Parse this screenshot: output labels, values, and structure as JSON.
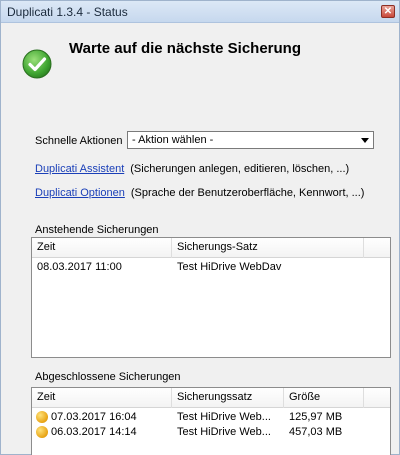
{
  "window": {
    "title": "Duplicati 1.3.4 - Status",
    "close_glyph": "✕"
  },
  "status": {
    "icon": "check-circle-icon",
    "text": "Warte auf die nächste Sicherung",
    "accent_color": "#4caf3c"
  },
  "quick_actions": {
    "label": "Schnelle Aktionen",
    "selected": "- Aktion wählen -"
  },
  "links": [
    {
      "label": "Duplicati Assistent",
      "description": "(Sicherungen anlegen, editieren, löschen, ...)"
    },
    {
      "label": "Duplicati Optionen",
      "description": "(Sprache der Benutzeroberfläche, Kennwort, ...)"
    }
  ],
  "pending": {
    "label": "Anstehende Sicherungen",
    "columns": [
      "Zeit",
      "Sicherungs-Satz"
    ],
    "rows": [
      {
        "time": "08.03.2017 11:00",
        "set": "Test HiDrive WebDav"
      }
    ]
  },
  "completed": {
    "label": "Abgeschlossene Sicherungen",
    "columns": [
      "Zeit",
      "Sicherungssatz",
      "Größe"
    ],
    "rows": [
      {
        "icon": "warning-bullet-icon",
        "time": "07.03.2017 16:04",
        "set": "Test HiDrive Web...",
        "size": "125,97 MB"
      },
      {
        "icon": "warning-bullet-icon",
        "time": "06.03.2017 14:14",
        "set": "Test HiDrive Web...",
        "size": "457,03 MB"
      }
    ]
  }
}
